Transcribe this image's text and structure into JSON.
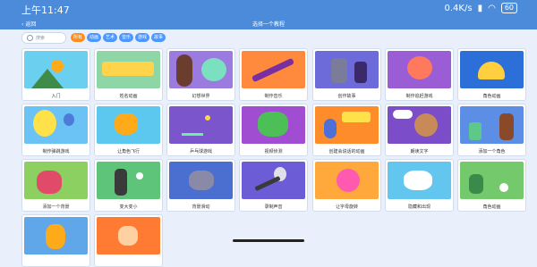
{
  "status": {
    "time": "上午11:47",
    "net_speed": "0.4K/s",
    "battery": "60"
  },
  "nav": {
    "back_label": "返回",
    "title": "选择一个教程"
  },
  "search": {
    "placeholder": "搜索"
  },
  "filters": [
    "所有",
    "动画",
    "艺术",
    "音乐",
    "游戏",
    "故事"
  ],
  "tutorials": [
    {
      "label": "入门",
      "color": "#6bd0f0",
      "icon": "cat-mountain-icon"
    },
    {
      "label": "姓名动画",
      "color": "#8ed6a6",
      "icon": "anya-letters-icon"
    },
    {
      "label": "幻想世界",
      "color": "#9c7be0",
      "icon": "fantasy-icon"
    },
    {
      "label": "制作音乐",
      "color": "#ff8a3d",
      "icon": "guitar-icon"
    },
    {
      "label": "创作故事",
      "color": "#6c6bd9",
      "icon": "wizard-icon"
    },
    {
      "label": "制作追赶游戏",
      "color": "#9b5dd6",
      "icon": "octopus-icon"
    },
    {
      "label": "角色动画",
      "color": "#2d6fd8",
      "icon": "taco-icon"
    },
    {
      "label": "制作弹跳游戏",
      "color": "#6bc3f5",
      "icon": "balloon-icon"
    },
    {
      "label": "让角色飞行",
      "color": "#5cc7ef",
      "icon": "flying-cat-icon"
    },
    {
      "label": "乒乓球游戏",
      "color": "#7a55cc",
      "icon": "pong-icon"
    },
    {
      "label": "视频侦测",
      "color": "#a04dd1",
      "icon": "dragon-icon"
    },
    {
      "label": "创建会说话的动画",
      "color": "#ff8c2a",
      "icon": "hello-icon"
    },
    {
      "label": "朗读文字",
      "color": "#7b4dc8",
      "icon": "speaker-icon"
    },
    {
      "label": "添加一个角色",
      "color": "#5d8ee6",
      "icon": "characters-icon"
    },
    {
      "label": "添加一个背景",
      "color": "#8bd060",
      "icon": "dino-icon"
    },
    {
      "label": "变大变小",
      "color": "#5dc47a",
      "icon": "giant-icon"
    },
    {
      "label": "背景滑动",
      "color": "#4a6fd0",
      "icon": "bat-icon"
    },
    {
      "label": "录制声音",
      "color": "#6c5dd6",
      "icon": "microphone-icon"
    },
    {
      "label": "让字母旋转",
      "color": "#ffa93d",
      "icon": "donut-icon"
    },
    {
      "label": "隐藏和出现",
      "color": "#62c6ee",
      "icon": "unicorn-icon"
    },
    {
      "label": "角色动画",
      "color": "#74c96d",
      "icon": "soccer-icon"
    },
    {
      "label": "",
      "color": "#5fa7e8",
      "icon": "cat-icon"
    },
    {
      "label": "",
      "color": "#ff7a33",
      "icon": "dog-icon"
    }
  ]
}
